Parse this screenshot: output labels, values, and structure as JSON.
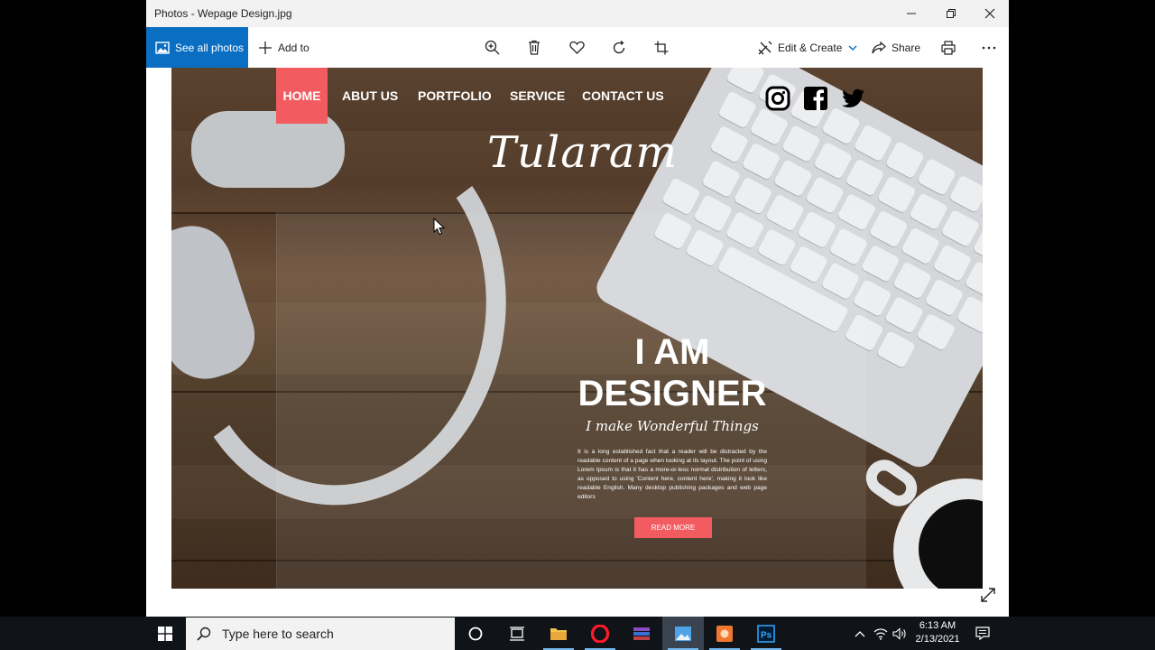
{
  "window": {
    "title": "Photos - Wepage Design.jpg"
  },
  "toolbar": {
    "see_all_label": "See all photos",
    "add_to_label": "Add to",
    "edit_create_label": "Edit & Create",
    "share_label": "Share"
  },
  "webpage": {
    "nav": [
      "HOME",
      "ABUT US",
      "PORTFOLIO",
      "SERVICE",
      "CONTACT US"
    ],
    "brand": "Tularam",
    "hero_line1": "I AM",
    "hero_line2": "DESIGNER",
    "tagline": "I make Wonderful Things",
    "paragraph": "It is a long established fact that a reader will be distracted by the readable content of a page when looking at its layout. The point of using Lorem Ipsum is that it has a more-or-less normal distribution of letters, as opposed to using 'Content here, content here', making it look like readable English. Many desktop publishing packages and web page editors",
    "button": "READ MORE",
    "accent": "#f25c61"
  },
  "taskbar": {
    "search_placeholder": "Type here to search",
    "time": "6:13 AM",
    "date": "2/13/2021"
  },
  "colors": {
    "accent_blue": "#0a6fc2",
    "taskbar": "#101418"
  }
}
